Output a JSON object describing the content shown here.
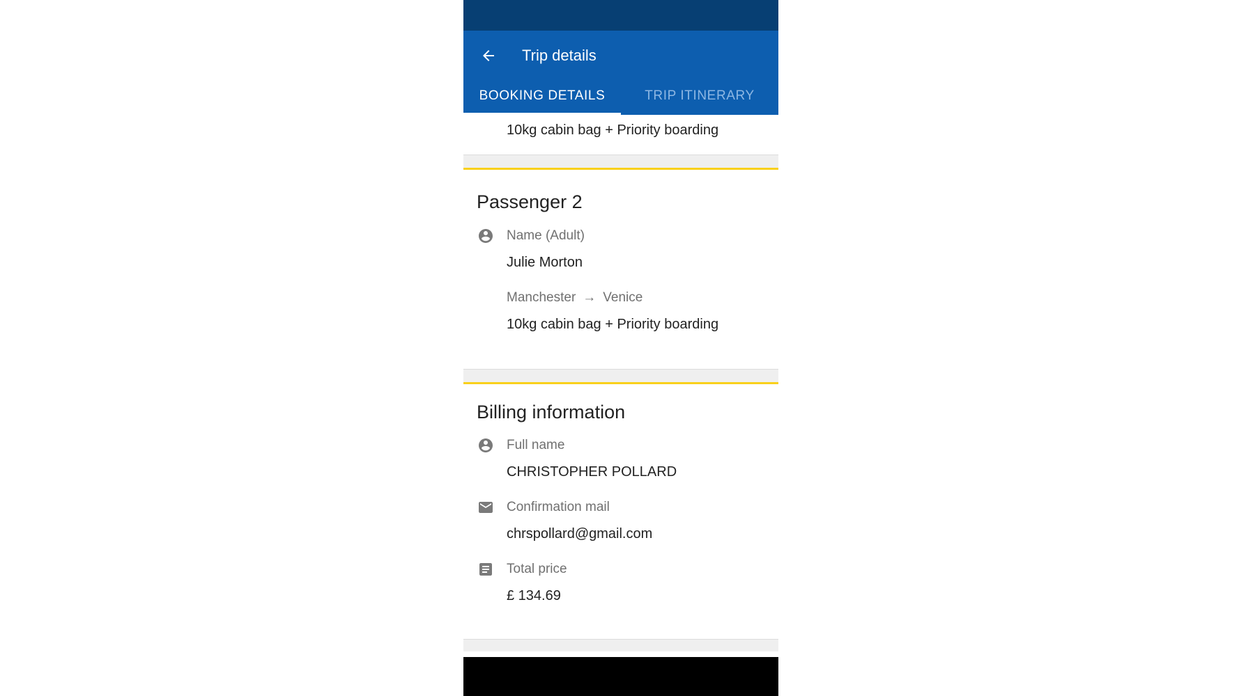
{
  "app_bar": {
    "title": "Trip details",
    "back_icon": "arrow-left-icon"
  },
  "tabs": [
    {
      "label": "BOOKING DETAILS",
      "active": true
    },
    {
      "label": "TRIP ITINERARY",
      "active": false
    }
  ],
  "top_remnant": {
    "extras": "10kg cabin bag + Priority boarding"
  },
  "passenger2": {
    "title": "Passenger 2",
    "name_label": "Name (Adult)",
    "name_value": "Julie Morton",
    "route_from": "Manchester",
    "route_arrow": "→",
    "route_to": "Venice",
    "extras": "10kg cabin bag + Priority boarding"
  },
  "billing": {
    "title": "Billing information",
    "full_name_label": "Full name",
    "full_name_value": "CHRISTOPHER POLLARD",
    "email_label": "Confirmation mail",
    "email_value": "chrspollard@gmail.com",
    "price_label": "Total price",
    "price_value": "£ 134.69"
  },
  "colors": {
    "status_bar": "#073F73",
    "app_bar": "#0D5EAF",
    "accent_yellow": "#F9D01B",
    "inactive_tab": "#8DB7E3"
  }
}
